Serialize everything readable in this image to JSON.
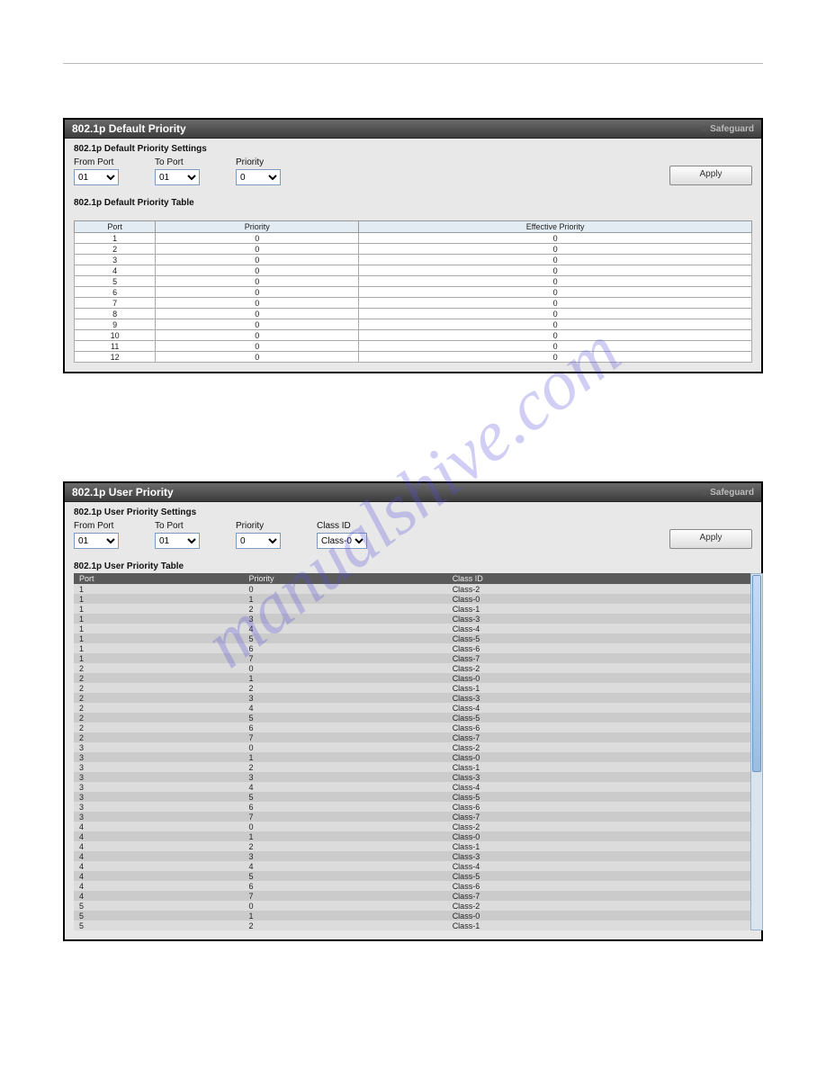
{
  "watermark": "manualshive.com",
  "panelA": {
    "title": "802.1p Default Priority",
    "safeguard": "Safeguard",
    "settingsHeader": "802.1p Default Priority Settings",
    "fromPort": {
      "label": "From Port",
      "value": "01"
    },
    "toPort": {
      "label": "To Port",
      "value": "01"
    },
    "priority": {
      "label": "Priority",
      "value": "0"
    },
    "apply": "Apply",
    "tableHeader": "802.1p Default Priority Table",
    "cols": [
      "Port",
      "Priority",
      "Effective Priority"
    ],
    "rows": [
      {
        "port": "1",
        "pri": "0",
        "eff": "0"
      },
      {
        "port": "2",
        "pri": "0",
        "eff": "0"
      },
      {
        "port": "3",
        "pri": "0",
        "eff": "0"
      },
      {
        "port": "4",
        "pri": "0",
        "eff": "0"
      },
      {
        "port": "5",
        "pri": "0",
        "eff": "0"
      },
      {
        "port": "6",
        "pri": "0",
        "eff": "0"
      },
      {
        "port": "7",
        "pri": "0",
        "eff": "0"
      },
      {
        "port": "8",
        "pri": "0",
        "eff": "0"
      },
      {
        "port": "9",
        "pri": "0",
        "eff": "0"
      },
      {
        "port": "10",
        "pri": "0",
        "eff": "0"
      },
      {
        "port": "11",
        "pri": "0",
        "eff": "0"
      },
      {
        "port": "12",
        "pri": "0",
        "eff": "0"
      }
    ]
  },
  "panelB": {
    "title": "802.1p User Priority",
    "safeguard": "Safeguard",
    "settingsHeader": "802.1p User Priority Settings",
    "fromPort": {
      "label": "From Port",
      "value": "01"
    },
    "toPort": {
      "label": "To Port",
      "value": "01"
    },
    "priority": {
      "label": "Priority",
      "value": "0"
    },
    "classId": {
      "label": "Class ID",
      "value": "Class-0"
    },
    "apply": "Apply",
    "tableHeader": "802.1p User Priority Table",
    "cols": [
      "Port",
      "Priority",
      "Class ID"
    ],
    "classMap": [
      "Class-2",
      "Class-0",
      "Class-1",
      "Class-3",
      "Class-4",
      "Class-5",
      "Class-6",
      "Class-7"
    ],
    "ports": [
      "1",
      "2",
      "3",
      "4",
      "5"
    ],
    "lastPortLimit": 3
  }
}
